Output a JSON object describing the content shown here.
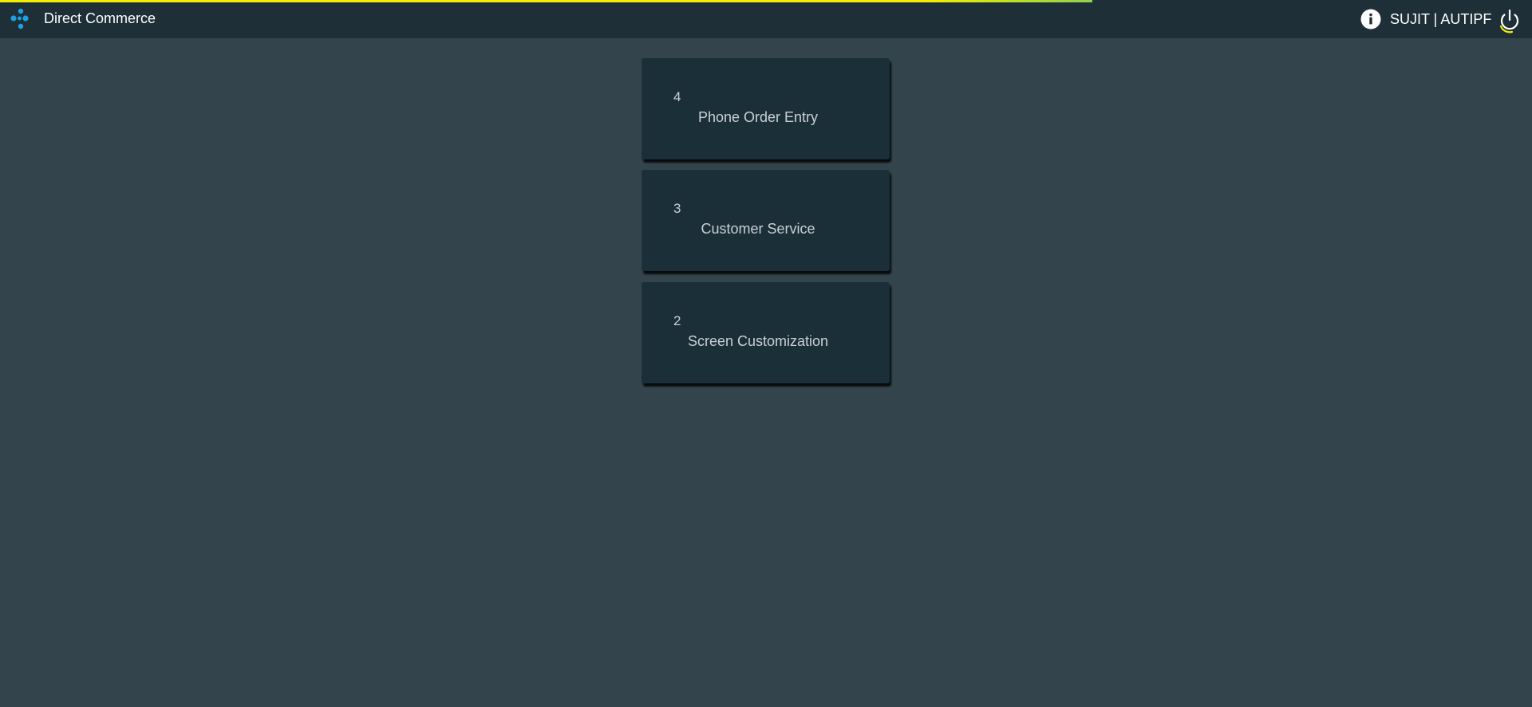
{
  "header": {
    "app_title": "Direct Commerce",
    "user": "SUJIT | AUTIPF",
    "logo_icon": "dots-cluster-logo-icon",
    "info_icon": "info-icon",
    "power_icon": "power-icon",
    "accent_color": "#1ba1e2",
    "progress_color": "#f2ee00"
  },
  "tiles": [
    {
      "count": "4",
      "label": "Phone Order Entry"
    },
    {
      "count": "3",
      "label": "Customer Service"
    },
    {
      "count": "2",
      "label": "Screen Customization"
    }
  ]
}
